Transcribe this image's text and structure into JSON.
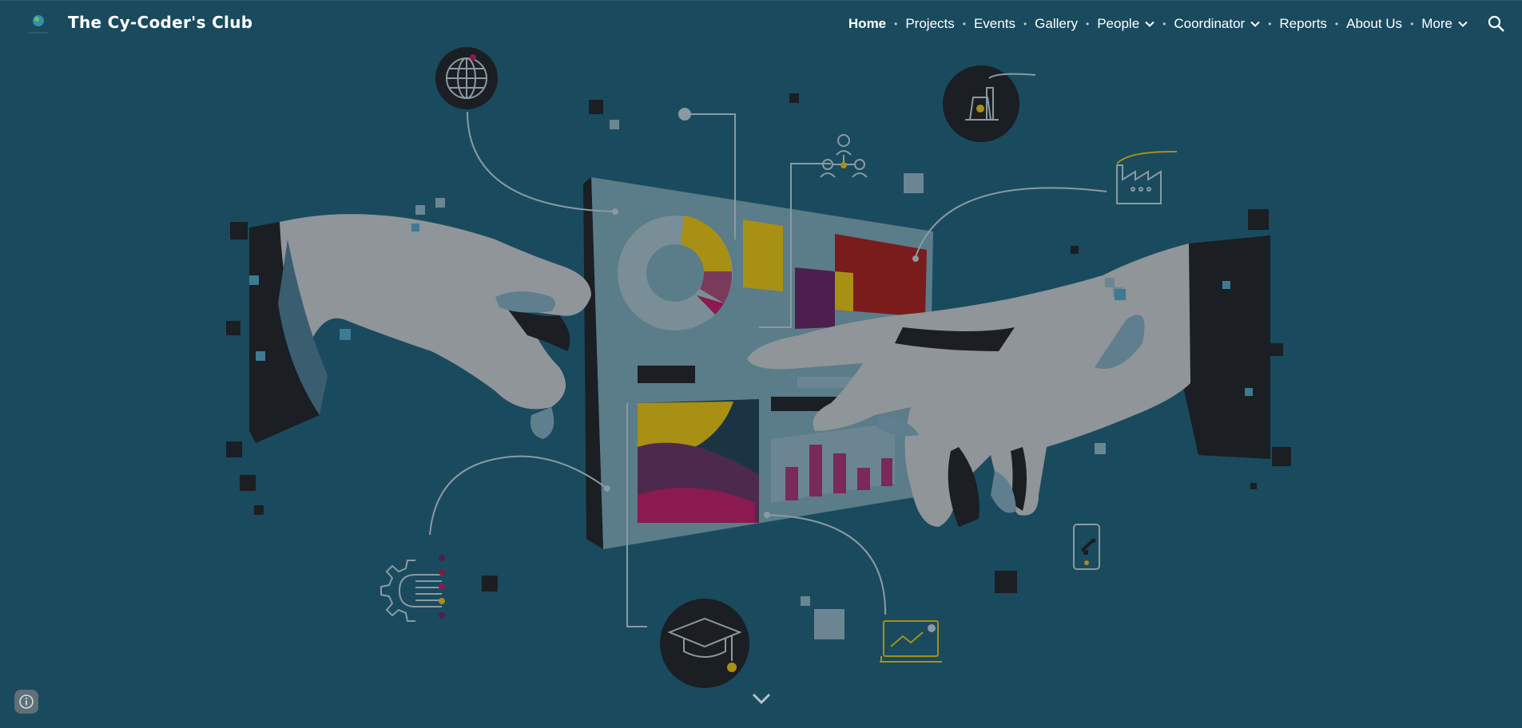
{
  "site": {
    "title": "The Cy-Coder's Club",
    "logo_icon": "club-logo-globe-icon"
  },
  "nav": {
    "items": [
      {
        "label": "Home",
        "active": true,
        "dropdown": false
      },
      {
        "label": "Projects",
        "active": false,
        "dropdown": false
      },
      {
        "label": "Events",
        "active": false,
        "dropdown": false
      },
      {
        "label": "Gallery",
        "active": false,
        "dropdown": false
      },
      {
        "label": "People",
        "active": false,
        "dropdown": true
      },
      {
        "label": "Coordinator",
        "active": false,
        "dropdown": true
      },
      {
        "label": "Reports",
        "active": false,
        "dropdown": false
      },
      {
        "label": "About Us",
        "active": false,
        "dropdown": false
      },
      {
        "label": "More",
        "active": false,
        "dropdown": true
      }
    ],
    "search_icon": "search-icon"
  },
  "hero": {
    "illustration": "hands-reaching-data-screen-illustration",
    "icons": [
      "globe-icon",
      "nuclear-plant-icon",
      "org-chart-icon",
      "factory-icon",
      "gear-circuit-icon",
      "graduation-cap-icon",
      "laptop-chart-icon",
      "smartphone-icon"
    ],
    "scroll_icon": "chevron-down-icon"
  },
  "footer": {
    "info_icon": "info-icon"
  },
  "colors": {
    "background": "#1a4a5e",
    "text": "#ffffff",
    "accent_yellow": "#a89014",
    "accent_magenta": "#7a1a4a",
    "accent_red": "#7a1c1c",
    "accent_purple": "#4d1f4f",
    "hand_gray": "#8f9599",
    "dark": "#1b1e22"
  }
}
